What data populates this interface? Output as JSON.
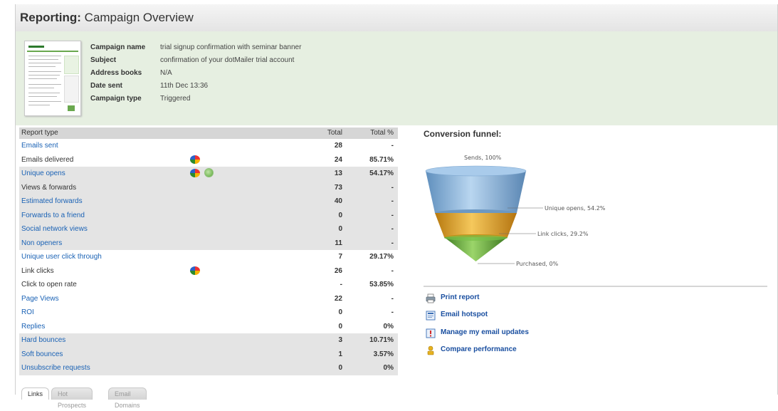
{
  "page": {
    "title_bold": "Reporting:",
    "title_rest": " Campaign Overview"
  },
  "campaign": {
    "labels": {
      "name": "Campaign name",
      "subject": "Subject",
      "address_books": "Address books",
      "date_sent": "Date sent",
      "campaign_type": "Campaign type"
    },
    "values": {
      "name": "trial signup confirmation with seminar banner",
      "subject": "confirmation of your dotMailer trial account",
      "address_books": "N/A",
      "date_sent": "11th Dec 13:36",
      "campaign_type": "Triggered"
    }
  },
  "report": {
    "headers": {
      "type": "Report type",
      "total": "Total",
      "pct": "Total %"
    },
    "rows": [
      {
        "label": "Emails sent",
        "total": "28",
        "pct": "-",
        "link": true,
        "shaded": false
      },
      {
        "label": "Emails delivered",
        "total": "24",
        "pct": "85.71%",
        "link": false,
        "shaded": false,
        "icons": [
          "pie-chart-icon"
        ]
      },
      {
        "label": "Unique opens",
        "total": "13",
        "pct": "54.17%",
        "link": true,
        "shaded": true,
        "icons": [
          "pie-chart-icon",
          "globe-icon"
        ]
      },
      {
        "label": "Views & forwards",
        "total": "73",
        "pct": "-",
        "link": false,
        "shaded": true
      },
      {
        "label": "Estimated forwards",
        "total": "40",
        "pct": "-",
        "link": true,
        "shaded": true
      },
      {
        "label": "Forwards to a friend",
        "total": "0",
        "pct": "-",
        "link": true,
        "shaded": true
      },
      {
        "label": "Social network views",
        "total": "0",
        "pct": "-",
        "link": true,
        "shaded": true
      },
      {
        "label": "Non openers",
        "total": "11",
        "pct": "-",
        "link": true,
        "shaded": true
      },
      {
        "label": "Unique user click through",
        "total": "7",
        "pct": "29.17%",
        "link": true,
        "shaded": false
      },
      {
        "label": "Link clicks",
        "total": "26",
        "pct": "-",
        "link": false,
        "shaded": false,
        "icons": [
          "pie-chart-icon"
        ]
      },
      {
        "label": "Click to open rate",
        "total": "-",
        "pct": "53.85%",
        "link": false,
        "shaded": false
      },
      {
        "label": "Page Views",
        "total": "22",
        "pct": "-",
        "link": true,
        "shaded": false
      },
      {
        "label": "ROI",
        "total": "0",
        "pct": "-",
        "link": true,
        "shaded": false
      },
      {
        "label": "Replies",
        "total": "0",
        "pct": "0%",
        "link": true,
        "shaded": false
      },
      {
        "label": "Hard bounces",
        "total": "3",
        "pct": "10.71%",
        "link": true,
        "shaded": true
      },
      {
        "label": "Soft bounces",
        "total": "1",
        "pct": "3.57%",
        "link": true,
        "shaded": true
      },
      {
        "label": "Unsubscribe requests",
        "total": "0",
        "pct": "0%",
        "link": true,
        "shaded": true
      }
    ]
  },
  "tabs": [
    "Links",
    "Hot Prospects",
    "Email Domains"
  ],
  "funnel": {
    "title": "Conversion funnel:",
    "stages": [
      {
        "label": "Sends, 100%",
        "value": 100,
        "color": "#8fb9df"
      },
      {
        "label": "Unique opens, 54.2%",
        "value": 54.2,
        "color": "#e3a72a"
      },
      {
        "label": "Link clicks, 29.2%",
        "value": 29.2,
        "color": "#5fa83c"
      },
      {
        "label": "Purchased, 0%",
        "value": 0,
        "color": "#5fa83c"
      }
    ]
  },
  "actions": [
    {
      "label": "Print report",
      "icon": "printer-icon"
    },
    {
      "label": "Email hotspot",
      "icon": "hotspot-icon"
    },
    {
      "label": "Manage my email updates",
      "icon": "email-updates-icon"
    },
    {
      "label": "Compare performance",
      "icon": "compare-icon"
    }
  ],
  "colors": {
    "link": "#1a62b5",
    "info_panel_bg": "#e6efe1",
    "row_shade": "#e4e4e4"
  }
}
